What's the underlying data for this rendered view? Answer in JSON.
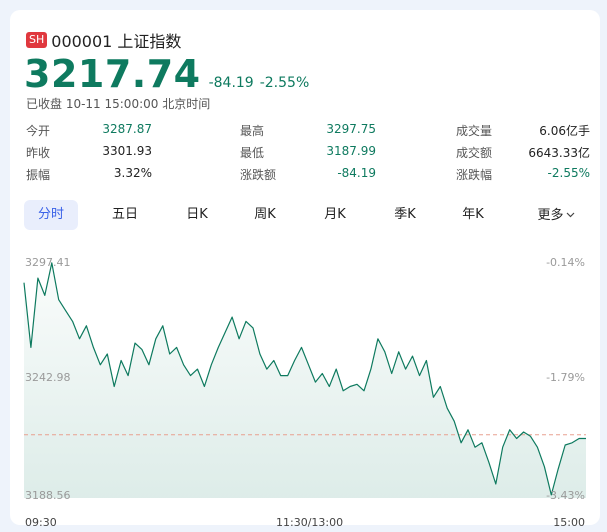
{
  "header": {
    "market_badge": "SH",
    "title": "000001 上证指数"
  },
  "quote": {
    "price": "3217.74",
    "change": "-84.19",
    "change_pct": "-2.55%",
    "status": "已收盘 10-11 15:00:00 北京时间"
  },
  "stats": {
    "open_label": "今开",
    "open": "3287.87",
    "prev_close_label": "昨收",
    "prev_close": "3301.93",
    "amplitude_label": "振幅",
    "amplitude": "3.32%",
    "high_label": "最高",
    "high": "3297.75",
    "low_label": "最低",
    "low": "3187.99",
    "change_amt_label": "涨跌额",
    "change_amt": "-84.19",
    "volume_label": "成交量",
    "volume": "6.06亿手",
    "turnover_label": "成交额",
    "turnover": "6643.33亿",
    "change_pct_label": "涨跌幅",
    "change_pct": "-2.55%"
  },
  "tabs": [
    "分时",
    "五日",
    "日K",
    "周K",
    "月K",
    "季K",
    "年K",
    "更多"
  ],
  "active_tab": "分时",
  "colors": {
    "down_green": "#0e7a5f",
    "up_red": "#e0383e",
    "accent_blue": "#3a62e8",
    "prev_close_line": "#e8a090"
  },
  "chart_data": {
    "type": "line",
    "x_start": "09:30",
    "x_mid": "11:30/13:00",
    "x_end": "15:00",
    "left_ticks": [
      "3297.41",
      "3242.98",
      "3188.56"
    ],
    "right_ticks": [
      "-0.14%",
      "-1.79%",
      "-3.43%"
    ],
    "ylim": [
      3188.56,
      3297.41
    ],
    "prev_close": 3301.93,
    "values": [
      3287.87,
      3258,
      3290,
      3282,
      3297,
      3280,
      3275,
      3270,
      3262,
      3268,
      3258,
      3250,
      3255,
      3240,
      3252,
      3245,
      3260,
      3257,
      3250,
      3262,
      3268,
      3255,
      3258,
      3250,
      3245,
      3248,
      3240,
      3250,
      3258,
      3265,
      3272,
      3262,
      3270,
      3267,
      3255,
      3248,
      3252,
      3245,
      3245,
      3252,
      3258,
      3250,
      3242,
      3246,
      3240,
      3248,
      3238,
      3240,
      3241,
      3238,
      3248,
      3262,
      3256,
      3246,
      3256,
      3248,
      3254,
      3245,
      3252,
      3235,
      3240,
      3230,
      3224,
      3214,
      3220,
      3212,
      3214,
      3205,
      3195,
      3212,
      3220,
      3216,
      3219,
      3217,
      3212,
      3203,
      3190,
      3202,
      3213,
      3214,
      3216,
      3216
    ]
  }
}
